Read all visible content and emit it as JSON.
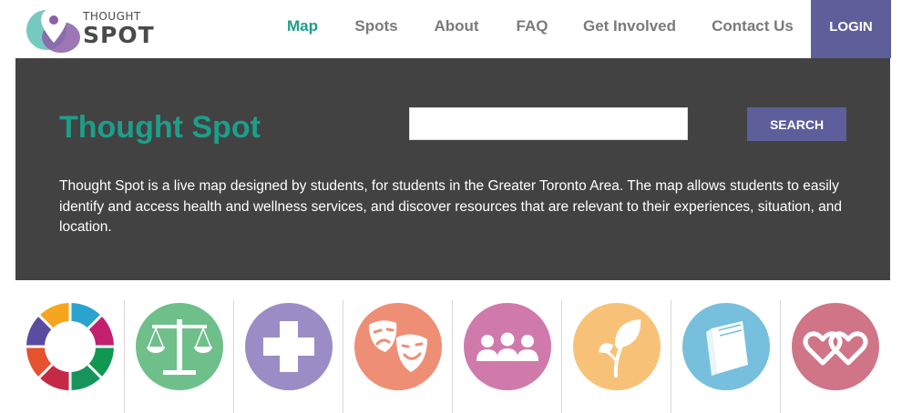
{
  "brand": {
    "line1": "THOUGHT",
    "line2": "SPOT",
    "teal": "#1d9e8a",
    "purple": "#5e5e9a"
  },
  "nav": {
    "items": [
      {
        "label": "Map",
        "active": true
      },
      {
        "label": "Spots",
        "active": false
      },
      {
        "label": "About",
        "active": false
      },
      {
        "label": "FAQ",
        "active": false
      },
      {
        "label": "Get Involved",
        "active": false
      },
      {
        "label": "Contact Us",
        "active": false
      }
    ],
    "login_label": "LOGIN"
  },
  "hero": {
    "title": "Thought Spot",
    "search_value": "",
    "search_button": "SEARCH",
    "description": "Thought Spot is a live map designed by students, for students in the Greater Toronto Area. The map allows students to easily identify and access health and wellness services, and discover resources that are relevant to their experiences, situation, and location."
  },
  "categories": [
    {
      "icon": "color-wheel-icon",
      "color": "multi"
    },
    {
      "icon": "scales-icon",
      "color": "#6fbf8a"
    },
    {
      "icon": "medical-cross-icon",
      "color": "#9b8cc6"
    },
    {
      "icon": "theater-masks-icon",
      "color": "#ee8e74"
    },
    {
      "icon": "people-group-icon",
      "color": "#cf7aab"
    },
    {
      "icon": "leaf-sprout-icon",
      "color": "#f7c277"
    },
    {
      "icon": "book-icon",
      "color": "#76bfdd"
    },
    {
      "icon": "hearts-icon",
      "color": "#d07487"
    }
  ]
}
